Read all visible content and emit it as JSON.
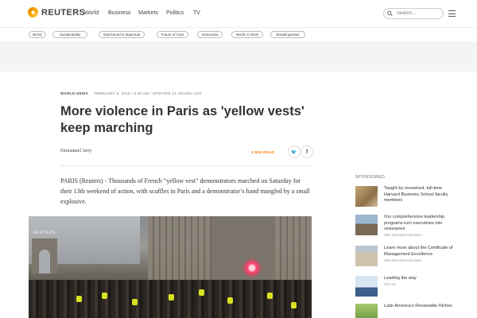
{
  "brand": {
    "name": "REUTERS",
    "logo_icon": "reuters-logo-icon",
    "accent": "#f7a600"
  },
  "nav": {
    "items": [
      "World",
      "Business",
      "Markets",
      "Politics",
      "TV"
    ]
  },
  "search": {
    "placeholder": "Search..."
  },
  "tags": [
    "Brexit",
    "Sustainability",
    "Imprisoned in Myanmar",
    "Future of Cars",
    "Venezuela",
    "World At Work",
    "Breakingviews"
  ],
  "article": {
    "section": "WORLD NEWS",
    "timestamp": "FEBRUARY 9, 2019 / 8:38 AM / UPDATED 21 HOURS AGO",
    "title": "More violence in Paris as 'yellow vests' keep marching",
    "author": "Emmanuel Jarry",
    "read_time": "3 MIN READ",
    "lede": "PARIS (Reuters) - Thousands of French “yellow vest” demonstrators marched on Saturday for their 13th weekend of action, with scuffles in Paris and a demonstrator’s hand mangled by a small explosive."
  },
  "share": {
    "twitter_icon": "twitter-icon",
    "facebook_icon": "facebook-icon",
    "twitter_glyph": "🐦",
    "facebook_glyph": "f"
  },
  "video": {
    "watermark": "REUTERS"
  },
  "sponsored": {
    "heading": "SPONSORED",
    "items": [
      {
        "title": "Taught by renowned, full-time Harvard Business School faculty members",
        "source": ""
      },
      {
        "title": "Our comprehensive leadership programs turn executives into visionaries",
        "source": "HBS Executive Education"
      },
      {
        "title": "Learn more about the Certificate of Management Excellence",
        "source": "HBS Executive Education"
      },
      {
        "title": "Leading the way",
        "source": "The AIC"
      },
      {
        "title": "Latin America's Renewable Riches",
        "source": ""
      }
    ]
  }
}
